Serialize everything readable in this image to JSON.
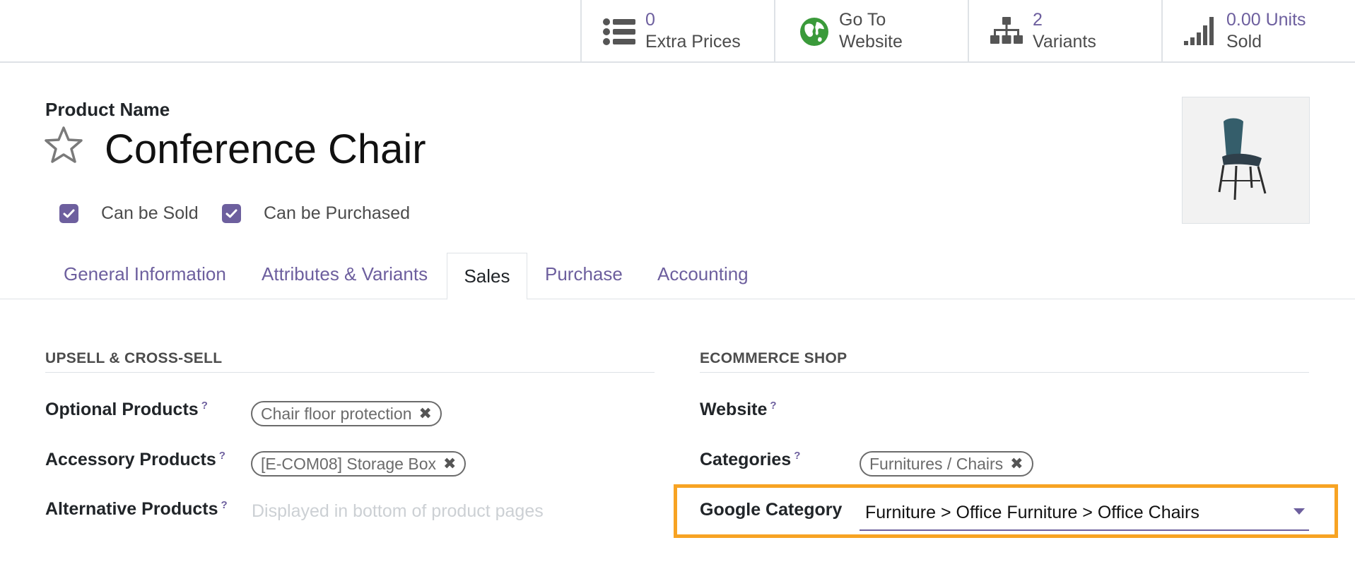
{
  "smart_buttons": [
    {
      "value": "0",
      "label": "Extra Prices",
      "icon": "list-icon"
    },
    {
      "value": "Go To",
      "label": "Website",
      "icon": "globe-icon"
    },
    {
      "value": "2",
      "label": "Variants",
      "icon": "sitemap-icon"
    },
    {
      "value": "0.00 Units",
      "label": "Sold",
      "icon": "signal-bars-icon"
    }
  ],
  "product": {
    "name_caption": "Product Name",
    "name": "Conference Chair",
    "can_be_sold": {
      "label": "Can be Sold",
      "checked": true
    },
    "can_be_purchased": {
      "label": "Can be Purchased",
      "checked": true
    },
    "image_alt": "chair-image"
  },
  "tabs": [
    {
      "label": "General Information",
      "active": false
    },
    {
      "label": "Attributes & Variants",
      "active": false
    },
    {
      "label": "Sales",
      "active": true
    },
    {
      "label": "Purchase",
      "active": false
    },
    {
      "label": "Accounting",
      "active": false
    }
  ],
  "upsell": {
    "title": "UPSELL & CROSS-SELL",
    "optional_products": {
      "label": "Optional Products",
      "help": "?",
      "tags": [
        "Chair floor protection"
      ]
    },
    "accessory_products": {
      "label": "Accessory Products",
      "help": "?",
      "tags": [
        "[E-COM08] Storage Box"
      ]
    },
    "alternative_products": {
      "label": "Alternative Products",
      "help": "?",
      "placeholder": "Displayed in bottom of product pages"
    }
  },
  "ecommerce": {
    "title": "ECOMMERCE SHOP",
    "website": {
      "label": "Website",
      "help": "?"
    },
    "categories": {
      "label": "Categories",
      "help": "?",
      "tags": [
        "Furnitures / Chairs"
      ]
    },
    "google_category": {
      "label": "Google Category",
      "value": "Furniture > Office Furniture > Office Chairs"
    }
  },
  "colors": {
    "accent": "#6d5f9e",
    "highlight": "#f7a323",
    "border": "#dee2e6"
  }
}
